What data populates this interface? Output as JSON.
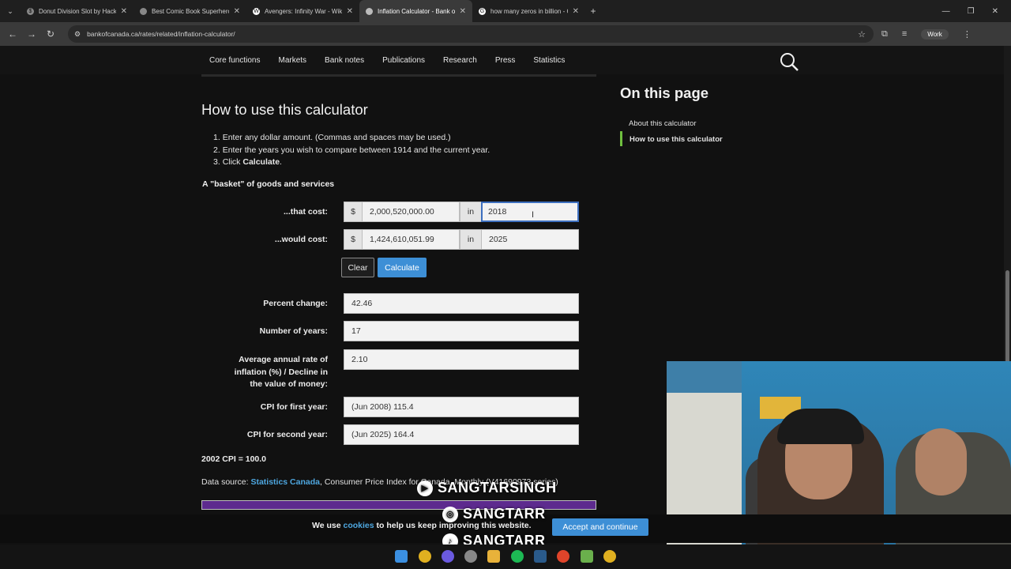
{
  "browser": {
    "tabs": [
      {
        "title": "Donut Division Slot by Hacksaw",
        "active": false
      },
      {
        "title": "Best Comic Book Superhero Mo",
        "active": false
      },
      {
        "title": "Avengers: Infinity War - Wikipe",
        "active": false
      },
      {
        "title": "Inflation Calculator - Bank of Ca",
        "active": true
      },
      {
        "title": "how many zeros in billion - Goo",
        "active": false
      }
    ],
    "url": "bankofcanada.ca/rates/related/inflation-calculator/",
    "profile": "Work"
  },
  "site_nav": {
    "links": [
      "Core functions",
      "Markets",
      "Bank notes",
      "Publications",
      "Research",
      "Press",
      "Statistics"
    ]
  },
  "main": {
    "heading": "How to use this calculator",
    "steps": [
      "Enter any dollar amount. (Commas and spaces may be used.)",
      "Enter the years you wish to compare between 1914 and the current year.",
      "Click Calculate."
    ],
    "step3_prefix": "Click ",
    "step3_bold": "Calculate",
    "step3_suffix": ".",
    "basket_label": "A \"basket\" of goods and services",
    "that_cost_label": "...that cost:",
    "that_cost_currency": "$",
    "that_cost_amount": "2,000,520,000.00",
    "in_label": "in",
    "that_cost_year": "2018",
    "would_cost_label": "...would cost:",
    "would_cost_amount": "1,424,610,051.99",
    "would_cost_year": "2025",
    "clear_label": "Clear",
    "calculate_label": "Calculate",
    "percent_change_label": "Percent change:",
    "percent_change_value": "42.46",
    "num_years_label": "Number of years:",
    "num_years_value": "17",
    "avg_rate_label_1": "Average annual rate of",
    "avg_rate_label_2": "inflation (%) / Decline in",
    "avg_rate_label_3": "the value of money:",
    "avg_rate_value": "2.10",
    "cpi_first_label": "CPI for first year:",
    "cpi_first_value": "(Jun 2008)  115.4",
    "cpi_second_label": "CPI for second year:",
    "cpi_second_value": "(Jun 2025)  164.4",
    "cpi_base": "2002 CPI = 100.0",
    "source_prefix": "Data source: ",
    "source_link": "Statistics Canada",
    "source_suffix": ", Consumer Price Index for Canada, Monthly (V41690973 series)"
  },
  "sidebar": {
    "heading": "On this page",
    "items": [
      "About this calculator",
      "How to use this calculator"
    ]
  },
  "cookie": {
    "prefix": "We use ",
    "link": "cookies",
    "suffix": " to help us keep improving this website.",
    "accept": "Accept and continue"
  },
  "watermarks": [
    "SANGTARSINGH",
    "SANGTARR",
    "SANGTARR"
  ],
  "colors": {
    "accent": "#3d8fd6",
    "link": "#4ea7e0",
    "active_marker": "#6fbf3f"
  }
}
